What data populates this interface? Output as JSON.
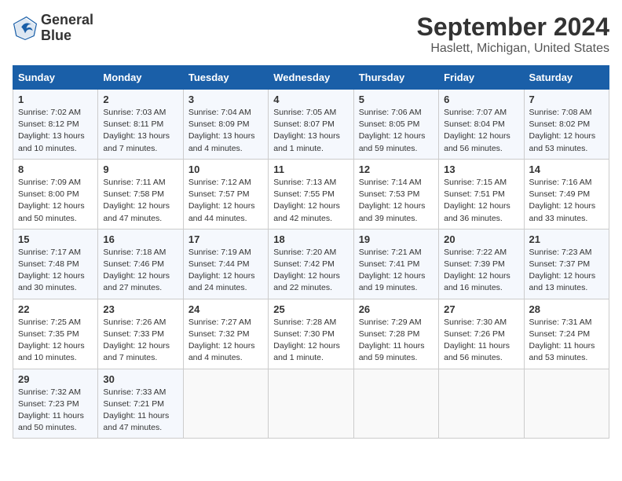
{
  "logo": {
    "line1": "General",
    "line2": "Blue"
  },
  "title": "September 2024",
  "subtitle": "Haslett, Michigan, United States",
  "headers": [
    "Sunday",
    "Monday",
    "Tuesday",
    "Wednesday",
    "Thursday",
    "Friday",
    "Saturday"
  ],
  "weeks": [
    [
      {
        "day": "1",
        "detail": "Sunrise: 7:02 AM\nSunset: 8:12 PM\nDaylight: 13 hours\nand 10 minutes."
      },
      {
        "day": "2",
        "detail": "Sunrise: 7:03 AM\nSunset: 8:11 PM\nDaylight: 13 hours\nand 7 minutes."
      },
      {
        "day": "3",
        "detail": "Sunrise: 7:04 AM\nSunset: 8:09 PM\nDaylight: 13 hours\nand 4 minutes."
      },
      {
        "day": "4",
        "detail": "Sunrise: 7:05 AM\nSunset: 8:07 PM\nDaylight: 13 hours\nand 1 minute."
      },
      {
        "day": "5",
        "detail": "Sunrise: 7:06 AM\nSunset: 8:05 PM\nDaylight: 12 hours\nand 59 minutes."
      },
      {
        "day": "6",
        "detail": "Sunrise: 7:07 AM\nSunset: 8:04 PM\nDaylight: 12 hours\nand 56 minutes."
      },
      {
        "day": "7",
        "detail": "Sunrise: 7:08 AM\nSunset: 8:02 PM\nDaylight: 12 hours\nand 53 minutes."
      }
    ],
    [
      {
        "day": "8",
        "detail": "Sunrise: 7:09 AM\nSunset: 8:00 PM\nDaylight: 12 hours\nand 50 minutes."
      },
      {
        "day": "9",
        "detail": "Sunrise: 7:11 AM\nSunset: 7:58 PM\nDaylight: 12 hours\nand 47 minutes."
      },
      {
        "day": "10",
        "detail": "Sunrise: 7:12 AM\nSunset: 7:57 PM\nDaylight: 12 hours\nand 44 minutes."
      },
      {
        "day": "11",
        "detail": "Sunrise: 7:13 AM\nSunset: 7:55 PM\nDaylight: 12 hours\nand 42 minutes."
      },
      {
        "day": "12",
        "detail": "Sunrise: 7:14 AM\nSunset: 7:53 PM\nDaylight: 12 hours\nand 39 minutes."
      },
      {
        "day": "13",
        "detail": "Sunrise: 7:15 AM\nSunset: 7:51 PM\nDaylight: 12 hours\nand 36 minutes."
      },
      {
        "day": "14",
        "detail": "Sunrise: 7:16 AM\nSunset: 7:49 PM\nDaylight: 12 hours\nand 33 minutes."
      }
    ],
    [
      {
        "day": "15",
        "detail": "Sunrise: 7:17 AM\nSunset: 7:48 PM\nDaylight: 12 hours\nand 30 minutes."
      },
      {
        "day": "16",
        "detail": "Sunrise: 7:18 AM\nSunset: 7:46 PM\nDaylight: 12 hours\nand 27 minutes."
      },
      {
        "day": "17",
        "detail": "Sunrise: 7:19 AM\nSunset: 7:44 PM\nDaylight: 12 hours\nand 24 minutes."
      },
      {
        "day": "18",
        "detail": "Sunrise: 7:20 AM\nSunset: 7:42 PM\nDaylight: 12 hours\nand 22 minutes."
      },
      {
        "day": "19",
        "detail": "Sunrise: 7:21 AM\nSunset: 7:41 PM\nDaylight: 12 hours\nand 19 minutes."
      },
      {
        "day": "20",
        "detail": "Sunrise: 7:22 AM\nSunset: 7:39 PM\nDaylight: 12 hours\nand 16 minutes."
      },
      {
        "day": "21",
        "detail": "Sunrise: 7:23 AM\nSunset: 7:37 PM\nDaylight: 12 hours\nand 13 minutes."
      }
    ],
    [
      {
        "day": "22",
        "detail": "Sunrise: 7:25 AM\nSunset: 7:35 PM\nDaylight: 12 hours\nand 10 minutes."
      },
      {
        "day": "23",
        "detail": "Sunrise: 7:26 AM\nSunset: 7:33 PM\nDaylight: 12 hours\nand 7 minutes."
      },
      {
        "day": "24",
        "detail": "Sunrise: 7:27 AM\nSunset: 7:32 PM\nDaylight: 12 hours\nand 4 minutes."
      },
      {
        "day": "25",
        "detail": "Sunrise: 7:28 AM\nSunset: 7:30 PM\nDaylight: 12 hours\nand 1 minute."
      },
      {
        "day": "26",
        "detail": "Sunrise: 7:29 AM\nSunset: 7:28 PM\nDaylight: 11 hours\nand 59 minutes."
      },
      {
        "day": "27",
        "detail": "Sunrise: 7:30 AM\nSunset: 7:26 PM\nDaylight: 11 hours\nand 56 minutes."
      },
      {
        "day": "28",
        "detail": "Sunrise: 7:31 AM\nSunset: 7:24 PM\nDaylight: 11 hours\nand 53 minutes."
      }
    ],
    [
      {
        "day": "29",
        "detail": "Sunrise: 7:32 AM\nSunset: 7:23 PM\nDaylight: 11 hours\nand 50 minutes."
      },
      {
        "day": "30",
        "detail": "Sunrise: 7:33 AM\nSunset: 7:21 PM\nDaylight: 11 hours\nand 47 minutes."
      },
      {
        "day": "",
        "detail": ""
      },
      {
        "day": "",
        "detail": ""
      },
      {
        "day": "",
        "detail": ""
      },
      {
        "day": "",
        "detail": ""
      },
      {
        "day": "",
        "detail": ""
      }
    ]
  ]
}
